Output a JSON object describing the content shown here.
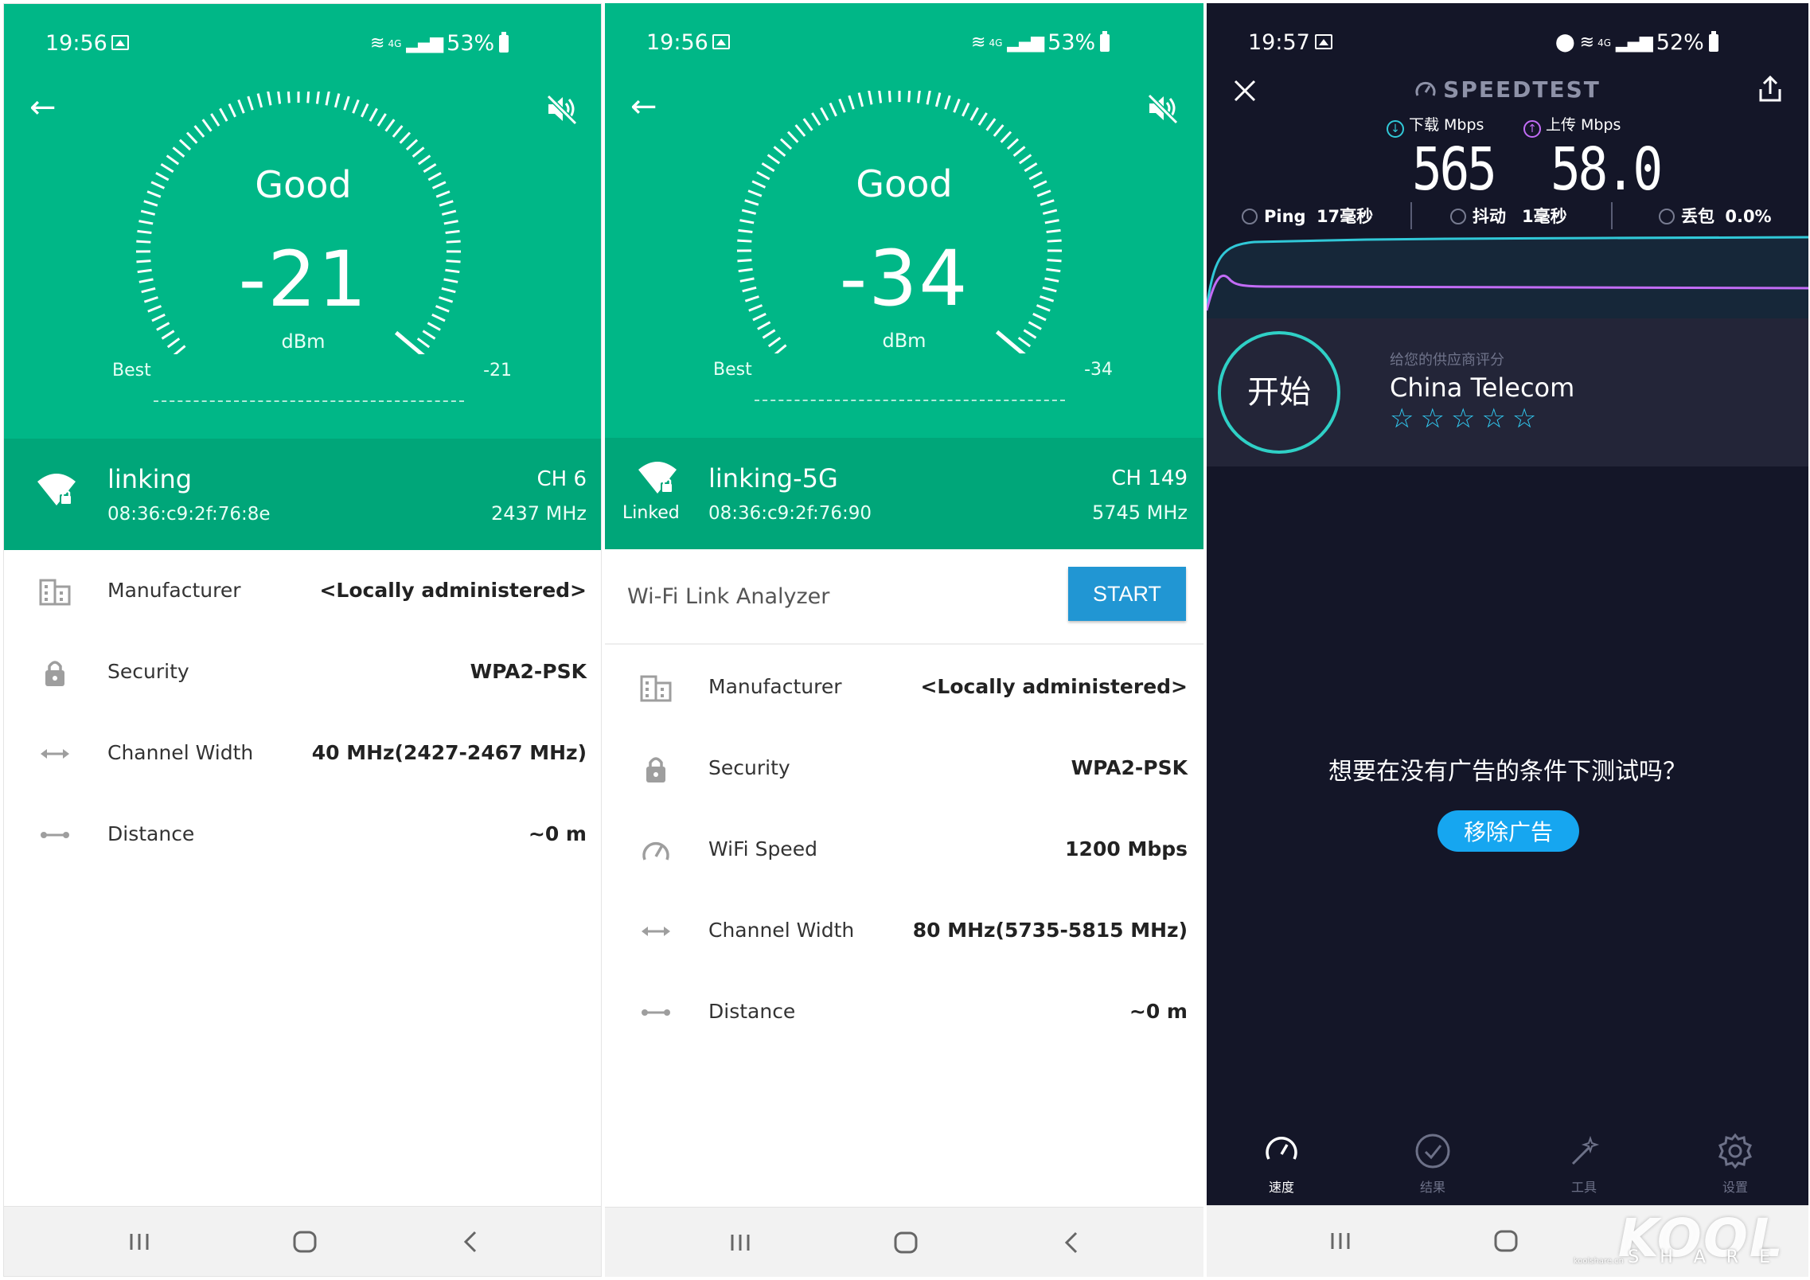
{
  "panels": [
    {
      "status": {
        "time": "19:56",
        "net": "4G",
        "battery": "53%"
      },
      "gauge": {
        "quality": "Good",
        "value": "-21",
        "unit": "dBm",
        "best_label": "Best",
        "best_value": "-21"
      },
      "network": {
        "ssid": "linking",
        "mac": "08:36:c9:2f:76:8e",
        "channel": "CH 6",
        "frequency": "2437 MHz",
        "linked_label": ""
      },
      "rows": [
        {
          "label": "Manufacturer",
          "value": "<Locally administered>"
        },
        {
          "label": "Security",
          "value": "WPA2-PSK"
        },
        {
          "label": "Channel Width",
          "value": "40 MHz(2427-2467 MHz)"
        },
        {
          "label": "Distance",
          "value": "~0 m"
        }
      ]
    },
    {
      "status": {
        "time": "19:56",
        "net": "4G",
        "battery": "53%"
      },
      "gauge": {
        "quality": "Good",
        "value": "-34",
        "unit": "dBm",
        "best_label": "Best",
        "best_value": "-34"
      },
      "network": {
        "ssid": "linking-5G",
        "mac": "08:36:c9:2f:76:90",
        "channel": "CH 149",
        "frequency": "5745 MHz",
        "linked_label": "Linked"
      },
      "analyzer": {
        "title": "Wi-Fi Link Analyzer",
        "button": "START"
      },
      "rows": [
        {
          "label": "Manufacturer",
          "value": "<Locally administered>"
        },
        {
          "label": "Security",
          "value": "WPA2-PSK"
        },
        {
          "label": "WiFi Speed",
          "value": "1200 Mbps"
        },
        {
          "label": "Channel Width",
          "value": "80 MHz(5735-5815 MHz)"
        },
        {
          "label": "Distance",
          "value": "~0 m"
        }
      ]
    }
  ],
  "speedtest": {
    "status": {
      "time": "19:57",
      "net": "4G",
      "battery": "52%"
    },
    "title": "SPEEDTEST",
    "download_label": "下载 Mbps",
    "upload_label": "上传 Mbps",
    "download_value": "565",
    "upload_value": "58.0",
    "ping": {
      "label": "Ping",
      "value": "17毫秒"
    },
    "jitter": {
      "label": "抖动",
      "value": "1毫秒"
    },
    "loss": {
      "label": "丢包",
      "value": "0.0%"
    },
    "go_label": "开始",
    "provider_label": "给您的供应商评分",
    "provider_name": "China Telecom",
    "stars": "☆☆☆☆☆",
    "ad_text": "想要在没有广告的条件下测试吗？",
    "ad_button": "移除广告",
    "tabs": [
      {
        "label": "速度"
      },
      {
        "label": "结果"
      },
      {
        "label": "工具"
      },
      {
        "label": "设置"
      }
    ],
    "colors": {
      "download": "#31c9d8",
      "upload": "#c26cf6",
      "accent": "#2fd0c6"
    }
  },
  "watermark": {
    "brand": "KOOL",
    "sub": "SHARE",
    "url": "koolshare.cn"
  },
  "colors": {
    "wifi_green": "#00b787",
    "wifi_green_dark": "#00a679",
    "start_button": "#2196d3"
  }
}
